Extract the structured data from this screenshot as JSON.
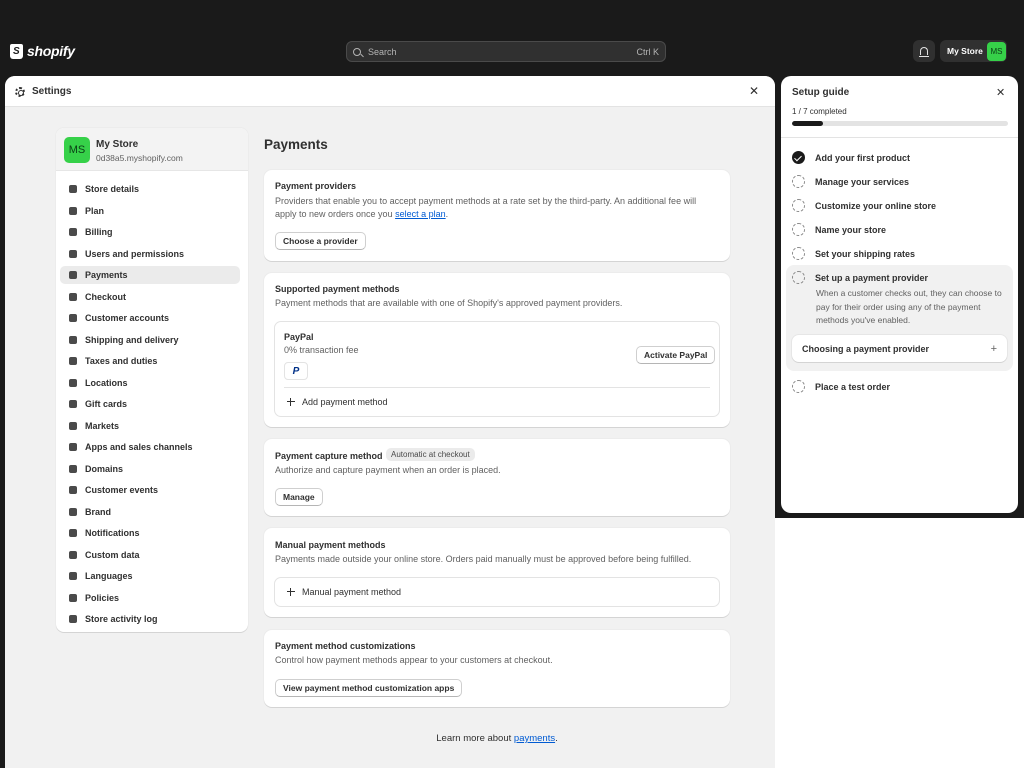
{
  "topbar": {
    "logo_text": "shopify",
    "search_placeholder": "Search",
    "search_shortcut": "Ctrl K",
    "store_name": "My Store",
    "store_initials": "MS"
  },
  "settings": {
    "title": "Settings",
    "close": "✕"
  },
  "nav": {
    "store_name": "My Store",
    "store_domain": "0d38a5.myshopify.com",
    "store_initials": "MS",
    "items": [
      {
        "label": "Store details"
      },
      {
        "label": "Plan"
      },
      {
        "label": "Billing"
      },
      {
        "label": "Users and permissions"
      },
      {
        "label": "Payments"
      },
      {
        "label": "Checkout"
      },
      {
        "label": "Customer accounts"
      },
      {
        "label": "Shipping and delivery"
      },
      {
        "label": "Taxes and duties"
      },
      {
        "label": "Locations"
      },
      {
        "label": "Gift cards"
      },
      {
        "label": "Markets"
      },
      {
        "label": "Apps and sales channels"
      },
      {
        "label": "Domains"
      },
      {
        "label": "Customer events"
      },
      {
        "label": "Brand"
      },
      {
        "label": "Notifications"
      },
      {
        "label": "Custom data"
      },
      {
        "label": "Languages"
      },
      {
        "label": "Policies"
      },
      {
        "label": "Store activity log"
      }
    ],
    "active_item": "Payments"
  },
  "main": {
    "page_title": "Payments",
    "providers": {
      "title": "Payment providers",
      "text_before_link": "Providers that enable you to accept payment methods at a rate set by the third-party. An additional fee will apply to new orders once you ",
      "link": "select a plan",
      "text_after_link": ".",
      "button": "Choose a provider"
    },
    "supported": {
      "title": "Supported payment methods",
      "text": "Payment methods that are available with one of Shopify's approved payment providers.",
      "paypal_name": "PayPal",
      "paypal_fee": "0% transaction fee",
      "paypal_logo": "P",
      "activate_button": "Activate PayPal",
      "add_method": "Add payment method"
    },
    "capture": {
      "title": "Payment capture method",
      "badge": "Automatic at checkout",
      "text": "Authorize and capture payment when an order is placed.",
      "button": "Manage"
    },
    "manual": {
      "title": "Manual payment methods",
      "text": "Payments made outside your online store. Orders paid manually must be approved before being fulfilled.",
      "add_manual": "Manual payment method"
    },
    "customizations": {
      "title": "Payment method customizations",
      "text": "Control how payment methods appear to your customers at checkout.",
      "button": "View payment method customization apps"
    },
    "learn_more_text": "Learn more about ",
    "learn_more_link": "payments",
    "learn_more_end": "."
  },
  "guide": {
    "title": "Setup guide",
    "close": "✕",
    "progress_text": "1 / 7 completed",
    "progress_fraction": 0.143,
    "steps": [
      {
        "label": "Add your first product",
        "done": true
      },
      {
        "label": "Manage your services",
        "done": false
      },
      {
        "label": "Customize your online store",
        "done": false
      },
      {
        "label": "Name your store",
        "done": false
      },
      {
        "label": "Set your shipping rates",
        "done": false
      },
      {
        "label": "Set up a payment provider",
        "done": false
      },
      {
        "label": "Place a test order",
        "done": false
      }
    ],
    "active_description": "When a customer checks out, they can choose to pay for their order using any of the payment methods you've enabled.",
    "active_sub_action": "Choosing a payment provider",
    "active_sub_plus": "+"
  }
}
